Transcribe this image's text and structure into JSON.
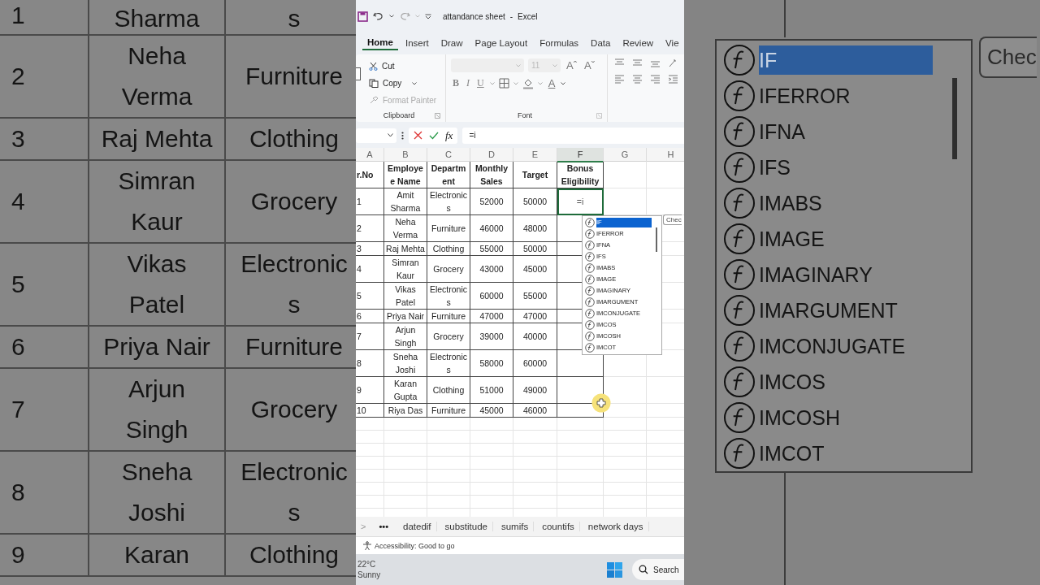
{
  "background_left": {
    "rows": [
      {
        "number": "1",
        "name": [
          "Sharma"
        ],
        "department": [
          "s"
        ]
      },
      {
        "number": "2",
        "name": [
          "Neha",
          "Verma"
        ],
        "department": [
          "Furniture"
        ]
      },
      {
        "number": "3",
        "name": [
          "Raj Mehta"
        ],
        "department": [
          "Clothing"
        ]
      },
      {
        "number": "4",
        "name": [
          "Simran",
          "Kaur"
        ],
        "department": [
          "Grocery"
        ]
      },
      {
        "number": "5",
        "name": [
          "Vikas",
          "Patel"
        ],
        "department": [
          "Electronic",
          "s"
        ]
      },
      {
        "number": "6",
        "name": [
          "Priya Nair"
        ],
        "department": [
          "Furniture"
        ]
      },
      {
        "number": "7",
        "name": [
          "Arjun",
          "Singh"
        ],
        "department": [
          "Grocery"
        ]
      },
      {
        "number": "8",
        "name": [
          "Sneha",
          "Joshi"
        ],
        "department": [
          "Electronic",
          "s"
        ]
      },
      {
        "number": "9",
        "name": [
          "Karan"
        ],
        "department": [
          "Clothing"
        ]
      }
    ]
  },
  "window": {
    "title": "attandance sheet",
    "separator": "-",
    "app": "Excel"
  },
  "ribbon_tabs": [
    {
      "label": "Home",
      "selected": true
    },
    {
      "label": "Insert",
      "selected": false
    },
    {
      "label": "Draw",
      "selected": false
    },
    {
      "label": "Page Layout",
      "selected": false
    },
    {
      "label": "Formulas",
      "selected": false
    },
    {
      "label": "Data",
      "selected": false
    },
    {
      "label": "Review",
      "selected": false
    },
    {
      "label": "Vie",
      "selected": false
    }
  ],
  "clipboard": {
    "items": [
      {
        "kind": "cut",
        "label": "Cut",
        "disabled": false
      },
      {
        "kind": "copy",
        "label": "Copy",
        "disabled": false
      },
      {
        "kind": "painter",
        "label": "Format Painter",
        "disabled": true
      }
    ],
    "label": "Clipboard"
  },
  "font": {
    "size": "11",
    "grow": "Aˆ",
    "shrink": "Aˇ",
    "styles": [
      "B",
      "I",
      "U"
    ],
    "color_letter": "A",
    "label": "Font"
  },
  "formula_bar": {
    "insert_function": "fx",
    "value": "=i"
  },
  "sheet": {
    "columns": [
      {
        "label": "A",
        "selected": false
      },
      {
        "label": "B",
        "selected": false
      },
      {
        "label": "C",
        "selected": false
      },
      {
        "label": "D",
        "selected": false
      },
      {
        "label": "E",
        "selected": false
      },
      {
        "label": "F",
        "selected": true
      },
      {
        "label": "G",
        "selected": false
      },
      {
        "label": "H",
        "selected": false
      }
    ],
    "rows": [
      {
        "header": true,
        "active": false,
        "cells": [
          [
            "r.No"
          ],
          [
            "Employe",
            "e Name"
          ],
          [
            "Departm",
            "ent"
          ],
          [
            "Monthly",
            "Sales"
          ],
          [
            "Target"
          ],
          [
            "Bonus",
            "Eligibility"
          ]
        ]
      },
      {
        "header": false,
        "active": true,
        "cells": [
          [
            "1"
          ],
          [
            "Amit",
            "Sharma"
          ],
          [
            "Electronic",
            "s"
          ],
          [
            "52000"
          ],
          [
            "50000"
          ],
          [
            "=i"
          ]
        ]
      },
      {
        "header": false,
        "active": false,
        "cells": [
          [
            "2"
          ],
          [
            "Neha",
            "Verma"
          ],
          [
            "Furniture"
          ],
          [
            "46000"
          ],
          [
            "48000"
          ]
        ]
      },
      {
        "header": false,
        "active": false,
        "cells": [
          [
            "3"
          ],
          [
            "Raj Mehta"
          ],
          [
            "Clothing"
          ],
          [
            "55000"
          ],
          [
            "50000"
          ]
        ]
      },
      {
        "header": false,
        "active": false,
        "cells": [
          [
            "4"
          ],
          [
            "Simran",
            "Kaur"
          ],
          [
            "Grocery"
          ],
          [
            "43000"
          ],
          [
            "45000"
          ]
        ]
      },
      {
        "header": false,
        "active": false,
        "cells": [
          [
            "5"
          ],
          [
            "Vikas",
            "Patel"
          ],
          [
            "Electronic",
            "s"
          ],
          [
            "60000"
          ],
          [
            "55000"
          ]
        ]
      },
      {
        "header": false,
        "active": false,
        "cells": [
          [
            "6"
          ],
          [
            "Priya Nair"
          ],
          [
            "Furniture"
          ],
          [
            "47000"
          ],
          [
            "47000"
          ]
        ]
      },
      {
        "header": false,
        "active": false,
        "cells": [
          [
            "7"
          ],
          [
            "Arjun",
            "Singh"
          ],
          [
            "Grocery"
          ],
          [
            "39000"
          ],
          [
            "40000"
          ]
        ]
      },
      {
        "header": false,
        "active": false,
        "cells": [
          [
            "8"
          ],
          [
            "Sneha",
            "Joshi"
          ],
          [
            "Electronic",
            "s"
          ],
          [
            "58000"
          ],
          [
            "60000"
          ]
        ]
      },
      {
        "header": false,
        "active": false,
        "cells": [
          [
            "9"
          ],
          [
            "Karan",
            "Gupta"
          ],
          [
            "Clothing"
          ],
          [
            "51000"
          ],
          [
            "49000"
          ]
        ]
      },
      {
        "header": false,
        "active": false,
        "cells": [
          [
            "10"
          ],
          [
            "Riya Das"
          ],
          [
            "Furniture"
          ],
          [
            "45000"
          ],
          [
            "46000"
          ]
        ]
      }
    ]
  },
  "autocomplete": {
    "items": [
      {
        "label": "IF",
        "selected": true
      },
      {
        "label": "IFERROR",
        "selected": false
      },
      {
        "label": "IFNA",
        "selected": false
      },
      {
        "label": "IFS",
        "selected": false
      },
      {
        "label": "IMABS",
        "selected": false
      },
      {
        "label": "IMAGE",
        "selected": false
      },
      {
        "label": "IMAGINARY",
        "selected": false
      },
      {
        "label": "IMARGUMENT",
        "selected": false
      },
      {
        "label": "IMCONJUGATE",
        "selected": false
      },
      {
        "label": "IMCOS",
        "selected": false
      },
      {
        "label": "IMCOSH",
        "selected": false
      },
      {
        "label": "IMCOT",
        "selected": false
      }
    ],
    "tooltip": "Chec"
  },
  "sheet_tabs": {
    "next": ">",
    "more": "•••",
    "tabs": [
      "datedif",
      "substitude",
      "sumifs",
      "countifs",
      "network days"
    ]
  },
  "status_bar": {
    "accessibility": "Accessibility: Good to go"
  },
  "taskbar": {
    "temperature": "22°C",
    "weather": "Sunny",
    "search": "Search"
  },
  "background_right": {
    "items": [
      {
        "label": "IF",
        "selected": true
      },
      {
        "label": "IFERROR",
        "selected": false
      },
      {
        "label": "IFNA",
        "selected": false
      },
      {
        "label": "IFS",
        "selected": false
      },
      {
        "label": "IMABS",
        "selected": false
      },
      {
        "label": "IMAGE",
        "selected": false
      },
      {
        "label": "IMAGINARY",
        "selected": false
      },
      {
        "label": "IMARGUMENT",
        "selected": false
      },
      {
        "label": "IMCONJUGATE",
        "selected": false
      },
      {
        "label": "IMCOS",
        "selected": false
      },
      {
        "label": "IMCOSH",
        "selected": false
      },
      {
        "label": "IMCOT",
        "selected": false
      }
    ],
    "tooltip": "Chec"
  }
}
